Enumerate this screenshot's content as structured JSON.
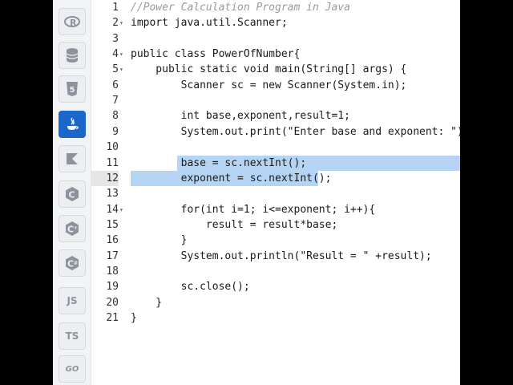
{
  "sidebar": {
    "languages": [
      {
        "name": "R",
        "icon": "r-icon"
      },
      {
        "name": "SQL",
        "icon": "database-icon"
      },
      {
        "name": "HTML5",
        "icon": "html5-icon"
      },
      {
        "name": "Java",
        "icon": "java-icon",
        "active": true
      },
      {
        "name": "Kotlin",
        "icon": "kotlin-icon"
      },
      {
        "name": "C",
        "icon": "c-icon"
      },
      {
        "name": "C++",
        "icon": "cpp-icon"
      },
      {
        "name": "C#",
        "icon": "csharp-icon"
      },
      {
        "name": "JS",
        "label": "JS",
        "icon": "js-icon"
      },
      {
        "name": "TS",
        "label": "TS",
        "icon": "ts-icon"
      },
      {
        "name": "Go",
        "label": "GO",
        "icon": "go-icon"
      }
    ]
  },
  "editor": {
    "lines": [
      {
        "n": "1",
        "text": "//Power Calculation Program in Java"
      },
      {
        "n": "2",
        "text": "import java.util.Scanner;"
      },
      {
        "n": "3",
        "text": ""
      },
      {
        "n": "4",
        "text": "public class PowerOfNumber{"
      },
      {
        "n": "5",
        "text": "    public static void main(String[] args) {"
      },
      {
        "n": "6",
        "text": "        Scanner sc = new Scanner(System.in);"
      },
      {
        "n": "7",
        "text": ""
      },
      {
        "n": "8",
        "text": "        int base,exponent,result=1;"
      },
      {
        "n": "9",
        "text": "        System.out.print(\"Enter base and exponent: \");"
      },
      {
        "n": "10",
        "text": ""
      },
      {
        "n": "11",
        "text": "        base = sc.nextInt();"
      },
      {
        "n": "12",
        "text": "        exponent = sc.nextInt();"
      },
      {
        "n": "13",
        "text": ""
      },
      {
        "n": "14",
        "text": "        for(int i=1; i<=exponent; i++){"
      },
      {
        "n": "15",
        "text": "            result = result*base;"
      },
      {
        "n": "16",
        "text": "        }"
      },
      {
        "n": "17",
        "text": "        System.out.println(\"Result = \" +result);"
      },
      {
        "n": "18",
        "text": ""
      },
      {
        "n": "19",
        "text": "        sc.close();"
      },
      {
        "n": "20",
        "text": "    }"
      },
      {
        "n": "21",
        "text": "}"
      }
    ],
    "fold_markers": [
      "2",
      "4",
      "5",
      "14"
    ],
    "fold_glyph": "▾"
  },
  "colors": {
    "active_language": "#1a66c9",
    "selection": "#b5d3f3",
    "comment": "#9a9a9a"
  }
}
